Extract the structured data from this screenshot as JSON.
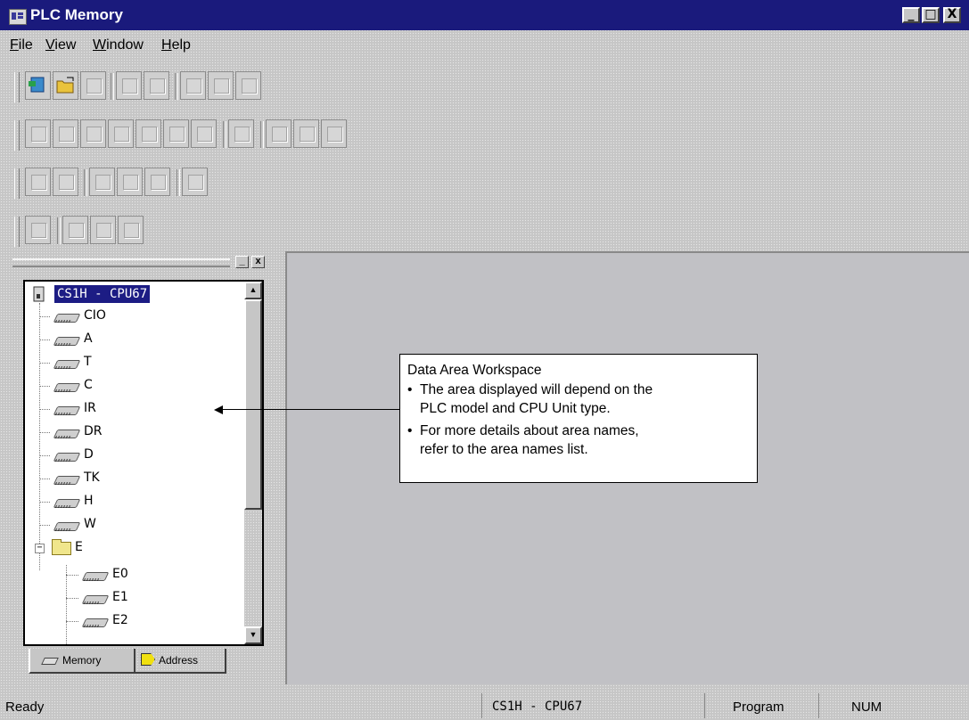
{
  "window": {
    "title": "PLC Memory",
    "controls": [
      "_",
      "□",
      "X"
    ]
  },
  "menu": [
    {
      "label_pre": "",
      "accel": "F",
      "label_post": "ile"
    },
    {
      "label_pre": "",
      "accel": "V",
      "label_post": "iew"
    },
    {
      "label_pre": "",
      "accel": "W",
      "label_post": "indow"
    },
    {
      "label_pre": "",
      "accel": "H",
      "label_post": "elp"
    }
  ],
  "panel": {
    "controls": [
      "_",
      "x"
    ],
    "root": "CS1H - CPU67",
    "items": [
      "CIO",
      "A",
      "T",
      "C",
      "IR",
      "DR",
      "D",
      "TK",
      "H",
      "W"
    ],
    "folder": {
      "label": "E",
      "expander": "−",
      "children": [
        "E0",
        "E1",
        "E2"
      ]
    },
    "tabs": {
      "memory": "Memory",
      "address": "Address"
    }
  },
  "callout": {
    "title": "Data Area Workspace",
    "bullet1_line1": "The area displayed will depend on the",
    "bullet1_line2": "PLC model and CPU Unit type.",
    "bullet2_line1": "For more details about area names,",
    "bullet2_line2": "refer to the area names list."
  },
  "statusbar": {
    "ready": "Ready",
    "plc": "CS1H - CPU67",
    "mode": "Program",
    "num": "NUM"
  }
}
